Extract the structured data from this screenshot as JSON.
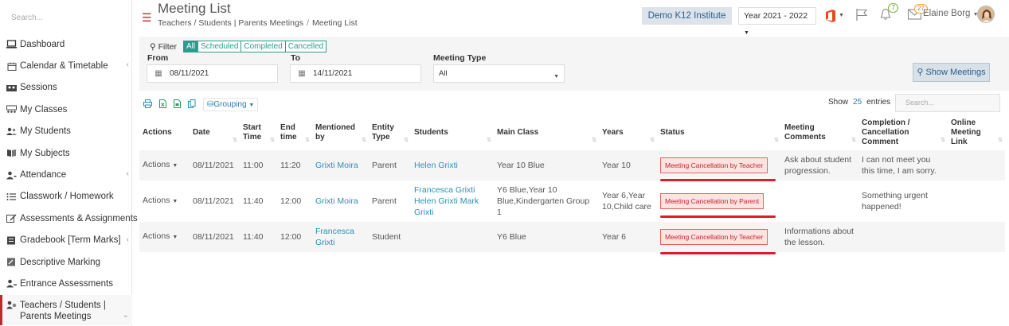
{
  "sidebar": {
    "search_placeholder": "Search...",
    "items": [
      {
        "label": "Dashboard",
        "icon": "laptop-icon"
      },
      {
        "label": "Calendar & Timetable",
        "icon": "calendar-icon",
        "expandable": true
      },
      {
        "label": "Sessions",
        "icon": "sessions-icon"
      },
      {
        "label": "My Classes",
        "icon": "classes-icon"
      },
      {
        "label": "My Students",
        "icon": "students-icon"
      },
      {
        "label": "My Subjects",
        "icon": "book-icon"
      },
      {
        "label": "Attendance",
        "icon": "attendance-icon",
        "expandable": true
      },
      {
        "label": "Classwork / Homework",
        "icon": "list-icon"
      },
      {
        "label": "Assessments & Assignments",
        "icon": "edit-icon"
      },
      {
        "label": "Gradebook [Term Marks]",
        "icon": "gradebook-icon",
        "expandable": true
      },
      {
        "label": "Descriptive Marking",
        "icon": "marking-icon"
      },
      {
        "label": "Entrance Assessments",
        "icon": "entrance-icon"
      },
      {
        "label": "Teachers / Students | Parents Meetings",
        "icon": "meetings-icon",
        "active": true
      }
    ]
  },
  "header": {
    "title": "Meeting List",
    "breadcrumb": [
      "Teachers / Students | Parents Meetings",
      "Meeting List"
    ],
    "institute": "Demo K12 Institute",
    "year": "Year 2021 - 2022",
    "notifications_count": "7",
    "messages_count": "27",
    "user_name": "Elaine Borg"
  },
  "filter": {
    "label": "Filter",
    "segments": [
      "All",
      "Scheduled",
      "Completed",
      "Cancelled"
    ],
    "active_segment": "All",
    "from_label": "From",
    "from_value": "08/11/2021",
    "to_label": "To",
    "to_value": "14/11/2021",
    "type_label": "Meeting Type",
    "type_value": "All",
    "show_button": "Show Meetings"
  },
  "toolbar": {
    "grouping_label": "Grouping",
    "show_label": "Show",
    "show_count": "25",
    "entries_label": "entries",
    "search_placeholder": "Search..."
  },
  "table": {
    "columns": [
      "Actions",
      "Date",
      "Start Time",
      "End time",
      "Mentioned by",
      "Entity Type",
      "Students",
      "Main Class",
      "Years",
      "Status",
      "Meeting Comments",
      "Completion / Cancellation Comment",
      "Online Meeting Link"
    ],
    "rows": [
      {
        "actions": "Actions",
        "date": "08/11/2021",
        "start": "11:00",
        "end": "11:20",
        "mentioned_by": "Grixti Moira",
        "entity": "Parent",
        "students": "Helen Grixti",
        "main_class": "Year 10 Blue",
        "years": "Year 10",
        "status": "Meeting Cancellation by Teacher",
        "comments": "Ask about student progression.",
        "cancel_comment": "I can not meet you this time, I am sorry.",
        "link": ""
      },
      {
        "actions": "Actions",
        "date": "08/11/2021",
        "start": "11:40",
        "end": "12:00",
        "mentioned_by": "Grixti Moira",
        "entity": "Parent",
        "students": "Francesca Grixti Helen Grixti Mark Grixti",
        "main_class": "Y6 Blue,Year 10 Blue,Kindergarten Group 1",
        "years": "Year 6,Year 10,Child care",
        "status": "Meeting Cancellation by Parent",
        "comments": "",
        "cancel_comment": "Something urgent happened!",
        "link": ""
      },
      {
        "actions": "Actions",
        "date": "08/11/2021",
        "start": "11:40",
        "end": "12:00",
        "mentioned_by": "Francesca Grixti",
        "entity": "Student",
        "students": "",
        "main_class": "Y6 Blue",
        "years": "Year 6",
        "status": "Meeting Cancellation by Teacher",
        "comments": "Informations about the lesson.",
        "cancel_comment": "",
        "link": ""
      }
    ]
  },
  "colors": {
    "brand_red": "#c1272d",
    "teal": "#2a9d8f",
    "link": "#2a8fb6",
    "status_red": "#c0252a",
    "underline_red": "#e4192b"
  }
}
